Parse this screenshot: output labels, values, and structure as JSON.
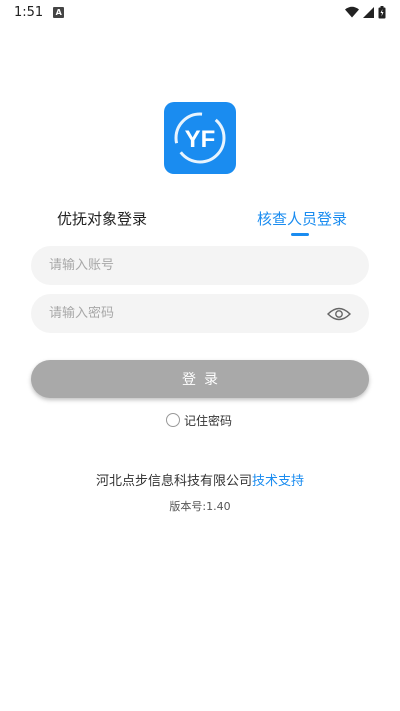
{
  "status_bar": {
    "time": "1:51",
    "notification_letter": "A"
  },
  "logo": {
    "text": "YF",
    "color": "#1a8cf0"
  },
  "tabs": [
    {
      "label": "优抚对象登录",
      "active": false
    },
    {
      "label": "核查人员登录",
      "active": true
    }
  ],
  "form": {
    "account_placeholder": "请输入账号",
    "account_value": "",
    "password_placeholder": "请输入密码",
    "password_value": "",
    "login_label": "登录",
    "remember_label": "记住密码"
  },
  "footer": {
    "company_text": "河北点步信息科技有限公司",
    "support_link": "技术支持",
    "version": "版本号:1.40"
  },
  "colors": {
    "accent": "#1a8cf0",
    "button_disabled": "#a9a9a9"
  }
}
